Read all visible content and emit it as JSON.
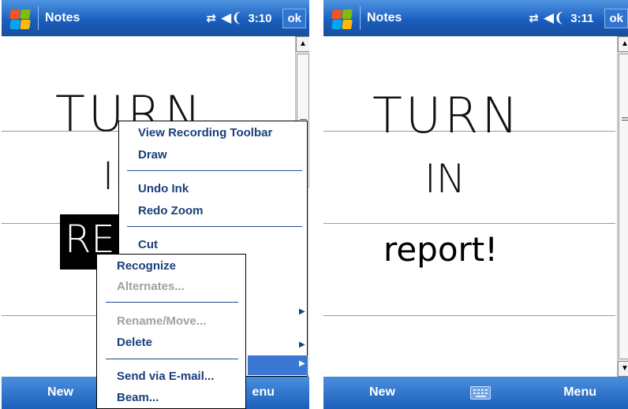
{
  "left": {
    "titlebar": {
      "app_title": "Notes",
      "clock": "3:10",
      "ok_label": "ok",
      "connectivity_icon": "connectivity-icon",
      "volume_icon": "volume-icon"
    },
    "ink": {
      "line1": "TURN",
      "line2": "IN",
      "line3": "RE"
    },
    "context_menu": {
      "items": [
        {
          "label": "View Recording Toolbar",
          "enabled": true
        },
        {
          "label": "Draw",
          "enabled": true
        },
        {
          "label": "Undo Ink",
          "enabled": true
        },
        {
          "label": "Redo Zoom",
          "enabled": true
        },
        {
          "label": "Cut",
          "enabled": true
        }
      ]
    },
    "submenu": {
      "items": [
        {
          "label": "Recognize",
          "enabled": true
        },
        {
          "label": "Alternates...",
          "enabled": false
        },
        {
          "label": "Rename/Move...",
          "enabled": false
        },
        {
          "label": "Delete",
          "enabled": true
        },
        {
          "label": "Send via E-mail...",
          "enabled": true
        },
        {
          "label": "Beam...",
          "enabled": true
        }
      ]
    },
    "menubar": {
      "new_label": "New",
      "menu_label": "Menu",
      "menu_visible_fragment": "enu"
    }
  },
  "right": {
    "titlebar": {
      "app_title": "Notes",
      "clock": "3:11",
      "ok_label": "ok"
    },
    "ink": {
      "line1": "TURN",
      "line2": "IN"
    },
    "recognized_text": "report!",
    "menubar": {
      "new_label": "New",
      "menu_label": "Menu",
      "keyboard_icon": "keyboard-icon"
    }
  },
  "colors": {
    "titlebar": "#1a5fbf",
    "menubar": "#1c5fbc",
    "menu_text": "#1a3f7a",
    "menu_highlight": "#3b78d4"
  }
}
